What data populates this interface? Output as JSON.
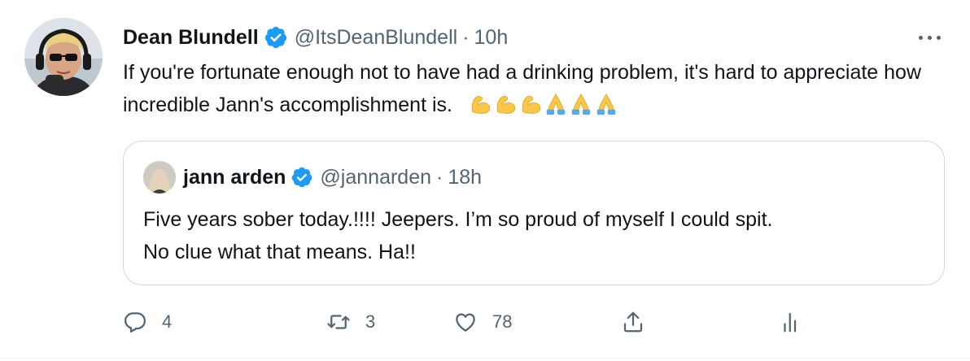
{
  "tweet": {
    "author_name": "Dean Blundell",
    "handle": "@ItsDeanBlundell",
    "separator": "·",
    "time": "10h",
    "text": "If you're fortunate enough not to have had a drinking problem, it's hard to appreciate how incredible Jann's accomplishment is.",
    "emojis": [
      "flexed-biceps",
      "flexed-biceps",
      "flexed-biceps",
      "folded-hands",
      "folded-hands",
      "folded-hands"
    ]
  },
  "quote": {
    "author_name": "jann arden",
    "handle": "@jannarden",
    "separator": "·",
    "time": "18h",
    "line1": "Five years sober today.!!!! Jeepers. I’m so proud of myself I could spit.",
    "line2": "No clue what that means. Ha!!"
  },
  "actions": {
    "reply_count": "4",
    "retweet_count": "3",
    "like_count": "78"
  },
  "icons": {
    "verified": "verified-badge-icon",
    "more": "more-icon",
    "reply": "reply-icon",
    "retweet": "retweet-icon",
    "like": "heart-icon",
    "share": "share-icon",
    "analytics": "analytics-icon"
  },
  "colors": {
    "verified_blue": "#1d9bf0",
    "secondary_text": "#536471",
    "primary_text": "#0f1419",
    "border": "#cfd9de"
  }
}
